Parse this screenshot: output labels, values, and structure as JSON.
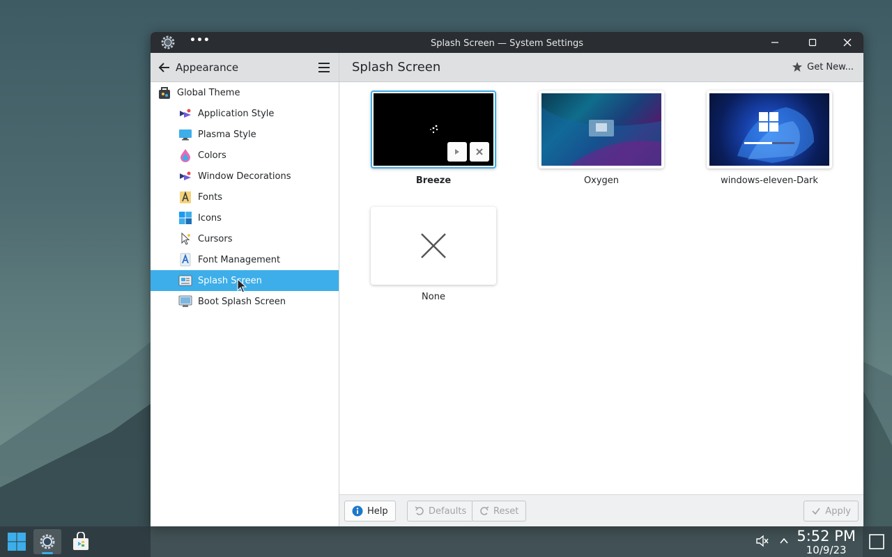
{
  "window": {
    "title": "Splash Screen — System Settings",
    "more_label": "•••"
  },
  "sidebar": {
    "section_title": "Appearance",
    "items": [
      {
        "label": "Global Theme",
        "icon": "global-theme-icon",
        "level": "top"
      },
      {
        "label": "Application Style",
        "icon": "application-style-icon",
        "level": "sub"
      },
      {
        "label": "Plasma Style",
        "icon": "plasma-style-icon",
        "level": "sub"
      },
      {
        "label": "Colors",
        "icon": "colors-icon",
        "level": "sub"
      },
      {
        "label": "Window Decorations",
        "icon": "window-decorations-icon",
        "level": "sub"
      },
      {
        "label": "Fonts",
        "icon": "fonts-icon",
        "level": "sub"
      },
      {
        "label": "Icons",
        "icon": "icons-icon",
        "level": "sub"
      },
      {
        "label": "Cursors",
        "icon": "cursors-icon",
        "level": "sub"
      },
      {
        "label": "Font Management",
        "icon": "font-management-icon",
        "level": "sub"
      },
      {
        "label": "Splash Screen",
        "icon": "splash-screen-icon",
        "level": "sub",
        "active": true
      },
      {
        "label": "Boot Splash Screen",
        "icon": "boot-splash-screen-icon",
        "level": "sub"
      }
    ]
  },
  "main": {
    "page_title": "Splash Screen",
    "get_new_label": "Get New...",
    "themes": [
      {
        "name": "Breeze",
        "selected": true
      },
      {
        "name": "Oxygen",
        "selected": false
      },
      {
        "name": "windows-eleven-Dark",
        "selected": false
      },
      {
        "name": "None",
        "selected": false
      }
    ]
  },
  "footer": {
    "help_label": "Help",
    "defaults_label": "Defaults",
    "reset_label": "Reset",
    "apply_label": "Apply"
  },
  "taskbar": {
    "time": "5:52 PM",
    "date": "10/9/23"
  },
  "colors": {
    "accent": "#3daee9",
    "titlebar": "#2a2d31",
    "header_bg": "#dee0e2"
  }
}
